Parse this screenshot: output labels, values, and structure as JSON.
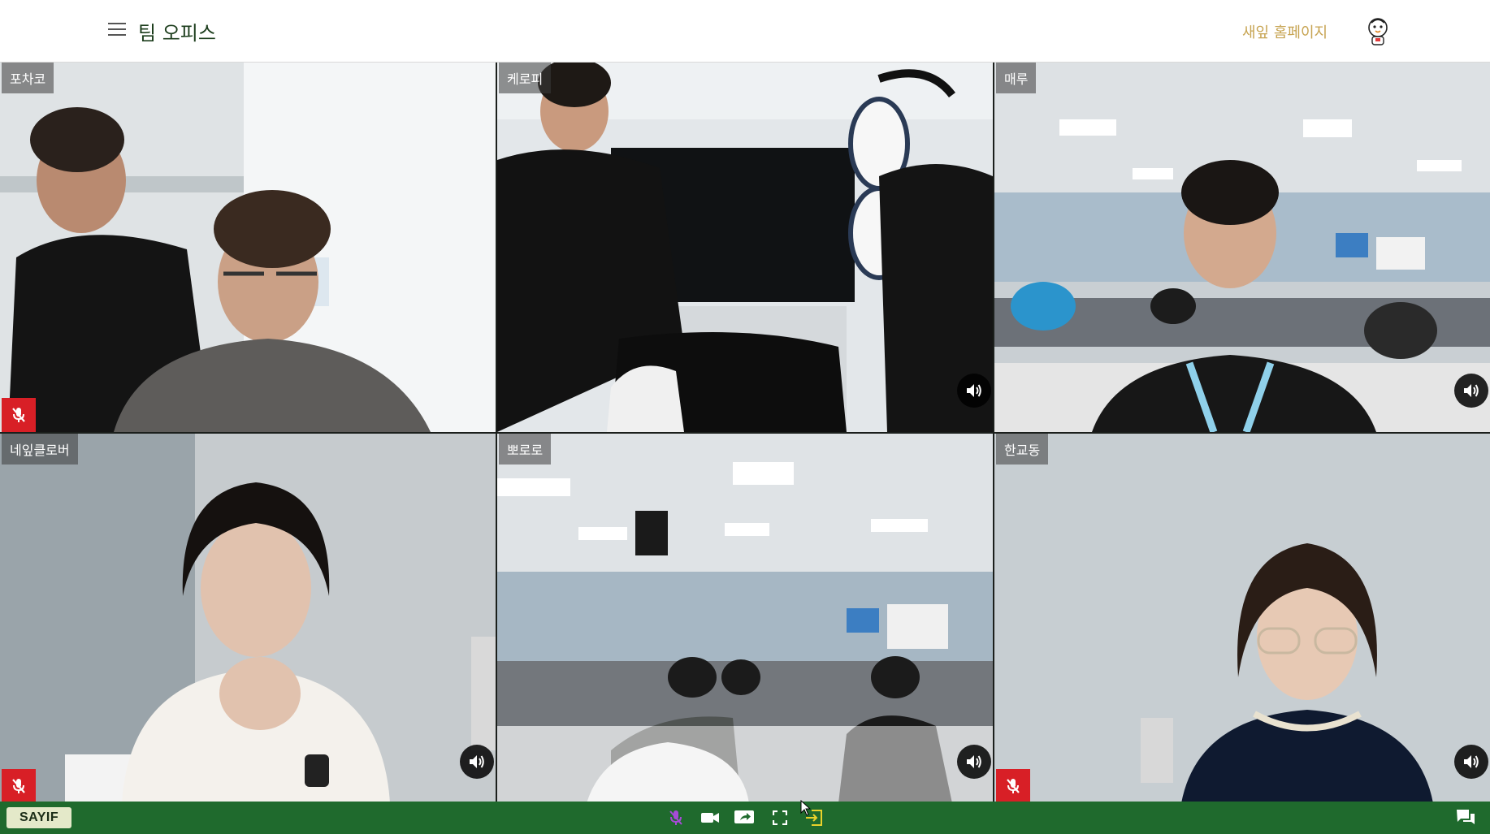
{
  "header": {
    "app_title": "팀 오피스",
    "home_link": "새잎 홈페이지",
    "menu_icon": "hamburger-menu-icon",
    "avatar_icon": "character-avatar-icon"
  },
  "participants": [
    {
      "name": "포차코",
      "muted": true,
      "speaker_button": false
    },
    {
      "name": "케로피",
      "muted": false,
      "speaker_button": true
    },
    {
      "name": "매루",
      "muted": false,
      "speaker_button": true
    },
    {
      "name": "네잎클로버",
      "muted": true,
      "speaker_button": true
    },
    {
      "name": "뽀로로",
      "muted": false,
      "speaker_button": true
    },
    {
      "name": "한교동",
      "muted": true,
      "speaker_button": true
    }
  ],
  "toolbar": {
    "brand": "SAYIF",
    "controls": [
      "microphone-muted-icon",
      "camera-icon",
      "screen-share-icon",
      "fullscreen-icon",
      "exit-room-icon",
      "chat-icon"
    ]
  },
  "colors": {
    "brand_green": "#1f6a2d",
    "home_link": "#c7a452",
    "mute_red": "#d81f26",
    "exit_yellow": "#e9d22b"
  }
}
